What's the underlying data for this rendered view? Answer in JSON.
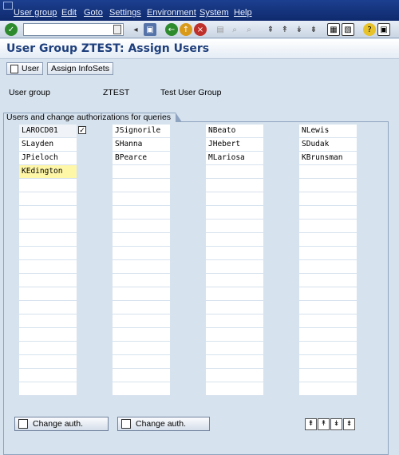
{
  "menubar": {
    "items": [
      "User group",
      "Edit",
      "Goto",
      "Settings",
      "Environment",
      "System",
      "Help"
    ]
  },
  "toolbar": {
    "command_field": "",
    "icons": [
      "enter-icon",
      "save-icon",
      "back-icon",
      "exit-icon",
      "cancel-icon",
      "print-icon",
      "find-icon",
      "find-next-icon",
      "first-page-icon",
      "prev-page-icon",
      "next-page-icon",
      "last-page-icon",
      "create-session-icon",
      "shortcut-icon",
      "help-icon",
      "customize-icon"
    ]
  },
  "title": "User Group ZTEST: Assign Users",
  "app_toolbar": {
    "user_button": "User",
    "infosets_button": "Assign InfoSets"
  },
  "info": {
    "label": "User group",
    "value": "ZTEST",
    "description": "Test User Group"
  },
  "section_title": "Users and change authorizations for queries",
  "users": {
    "col1": [
      "LAROCD01",
      "SLayden",
      "JPieloch",
      "KEdington"
    ],
    "col2": [
      "JSignorile",
      "SHanna",
      "BPearce"
    ],
    "col3": [
      "NBeato",
      "JHebert",
      "MLariosa"
    ],
    "col4": [
      "NLewis",
      "SDudak",
      "KBrunsman"
    ]
  },
  "bottom": {
    "change_auth_1": "Change auth.",
    "change_auth_2": "Change auth."
  }
}
